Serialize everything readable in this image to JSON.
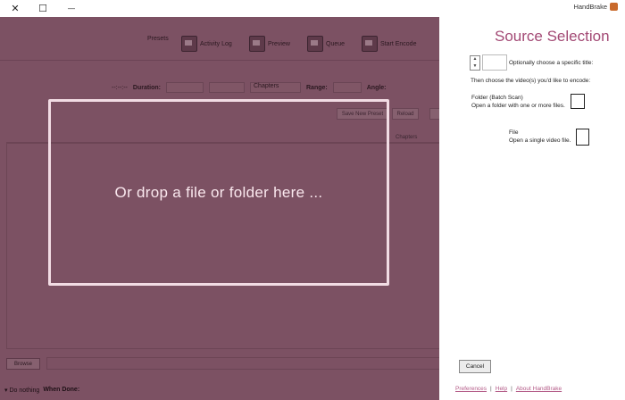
{
  "window": {
    "title": "HandBrake",
    "close_glyph": "✕",
    "maximize_glyph": "☐",
    "minimize_glyph": "—"
  },
  "toolbar": {
    "items": [
      {
        "label": "Start Encode",
        "icon": "play-icon"
      },
      {
        "label": "Queue",
        "icon": "queue-icon"
      },
      {
        "label": "Preview",
        "icon": "preview-icon"
      },
      {
        "label": "Activity Log",
        "icon": "activity-log-icon"
      },
      {
        "label": "Presets",
        "icon": "presets-icon"
      }
    ]
  },
  "source_row": {
    "angle_label": "Angle:",
    "range_label": "Range:",
    "range_value": "Chapters",
    "duration_label": "Duration:",
    "duration_value": "--:--:--"
  },
  "presets_row": {
    "reload_label": "Reload",
    "save_preset_label": "Save New Preset"
  },
  "tabs": {
    "chapters_label": "Chapters"
  },
  "destination": {
    "browse_label": "Browse"
  },
  "status": {
    "when_done_label": "When Done:",
    "when_done_value": "Do nothing"
  },
  "dropzone": {
    "text": "Or drop a file or folder here ..."
  },
  "source_panel": {
    "title": "Source Selection",
    "title_prompt": "Optionally choose a specific title:",
    "choose_prompt": "Then choose the video(s) you'd like to encode:",
    "folder_title": "Folder (Batch Scan)",
    "folder_desc": "Open a folder with one or more files.",
    "file_title": "File",
    "file_desc": "Open a single video file.",
    "cancel_label": "Cancel",
    "footer": {
      "preferences": "Preferences",
      "help": "Help",
      "about": "About HandBrake",
      "separator": "|"
    }
  },
  "colors": {
    "overlay": "#7c5163",
    "accent": "#a34a75",
    "dropzone_border": "#f2dce4"
  }
}
